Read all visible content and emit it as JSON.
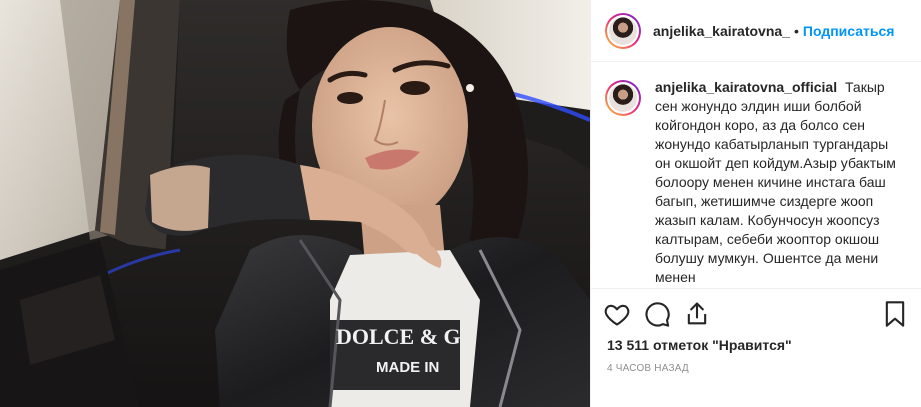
{
  "header": {
    "username": "anjelika_kairatovna_",
    "separator": "•",
    "follow_label": "Подписаться"
  },
  "caption": {
    "username": "anjelika_kairatovna_official",
    "text": "Такыр сен жонундо элдин иши болбой койгондон коро, аз да болсо сен жонундо кабатырланып тургандары он окшойт деп койдум.Азыр убактым болоору менен кичине инстага баш багып, жетишимче сиздерге жооп жазып калам. Кобунчосун жоопсуз калтырам, себеби жооптор окшош болушу мумкун. Ошентсе да мени менен"
  },
  "photo": {
    "shirt_text_line1": "DOLCE & G",
    "shirt_text_line2": "MADE IN"
  },
  "actions": {
    "like_icon": "heart-icon",
    "comment_icon": "comment-icon",
    "share_icon": "share-icon",
    "save_icon": "bookmark-icon"
  },
  "likes": {
    "count": "13 511",
    "label_middle": "отметок",
    "label_end": "\"Нравится\""
  },
  "timestamp": "4 ЧАСОВ НАЗАД"
}
